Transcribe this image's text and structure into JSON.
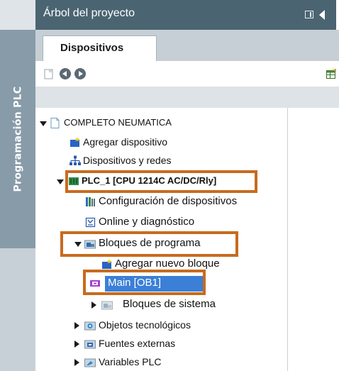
{
  "sidebar": {
    "vertical_label": "Programación PLC"
  },
  "header": {
    "title": "Árbol del proyecto"
  },
  "tabs": [
    {
      "label": "Dispositivos",
      "active": true
    }
  ],
  "toolbar": {
    "icons": [
      "new-page-icon",
      "back-icon",
      "forward-icon",
      "table-icon"
    ]
  },
  "tree": {
    "project": {
      "label": "COMPLETO NEUMATICA",
      "icon": "project-page-icon",
      "expanded": true
    },
    "add_device": {
      "label": "Agregar dispositivo",
      "icon": "add-device-icon"
    },
    "devices_networks": {
      "label": "Dispositivos y redes",
      "icon": "network-icon"
    },
    "plc": {
      "label": "PLC_1 [CPU 1214C AC/DC/Rly]",
      "icon": "plc-icon",
      "expanded": true,
      "highlighted": true
    },
    "device_config": {
      "label": "Configuración de dispositivos",
      "icon": "device-config-icon"
    },
    "online_diag": {
      "label": "Online y diagnóstico",
      "icon": "online-diagnostic-icon"
    },
    "program_blocks": {
      "label": "Bloques de programa",
      "icon": "folder-icon",
      "expanded": true,
      "highlighted": true
    },
    "add_block": {
      "label": "Agregar nuevo bloque",
      "icon": "add-block-icon"
    },
    "main_block": {
      "label": "Main [OB1]",
      "icon": "ob-block-icon",
      "selected": true,
      "highlighted": true
    },
    "system_blocks": {
      "label": "Bloques de sistema",
      "icon": "folder-icon",
      "expanded": false
    },
    "tech_objects": {
      "label": "Objetos tecnológicos",
      "icon": "folder-icon",
      "expanded": false
    },
    "external_sources": {
      "label": "Fuentes externas",
      "icon": "folder-icon",
      "expanded": false
    },
    "plc_variables": {
      "label": "Variables PLC",
      "icon": "folder-icon",
      "expanded": false
    }
  },
  "colors": {
    "title_bar": "#4b6472",
    "vertical_strip": "#889ba8",
    "highlight_box": "#c76b1f",
    "selection": "#3b7fd6"
  }
}
